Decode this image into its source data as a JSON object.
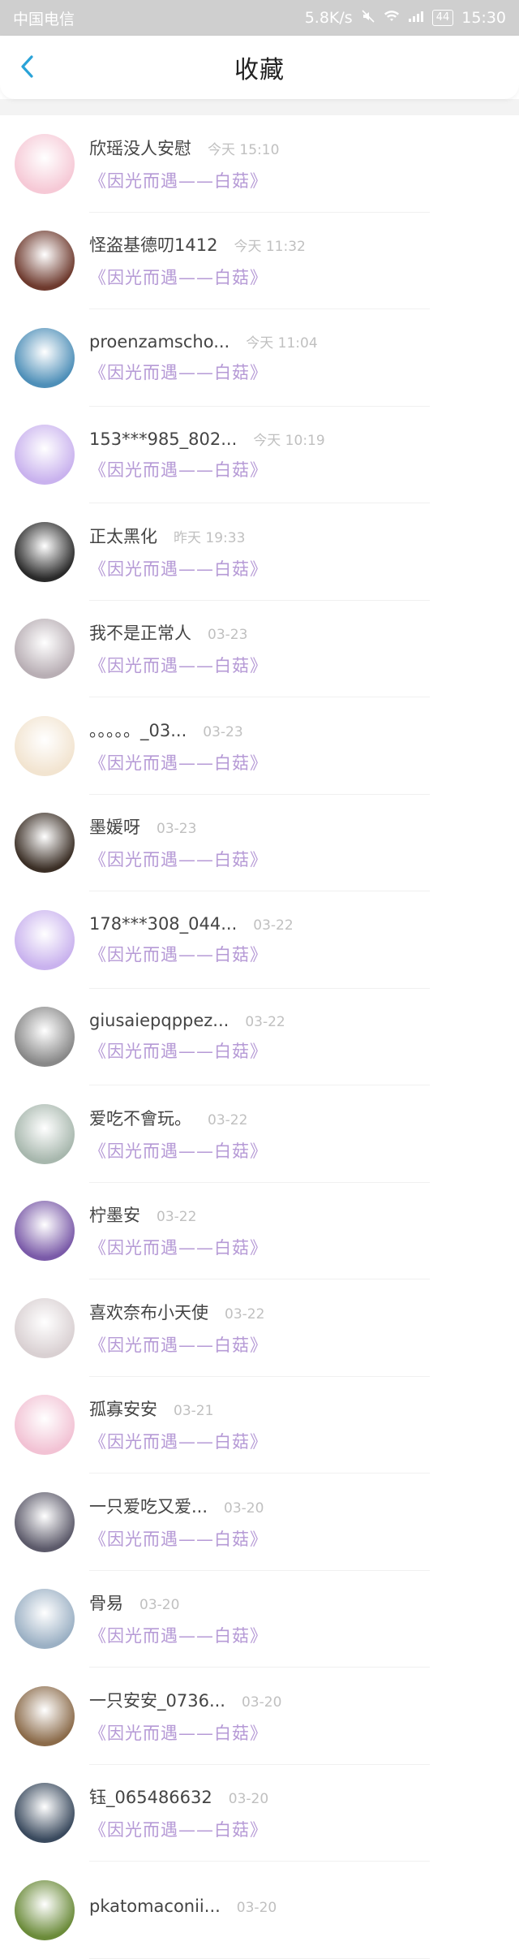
{
  "status": {
    "carrier": "中国电信",
    "speed": "5.8K/s",
    "battery": "44",
    "time": "15:30"
  },
  "header": {
    "title": "收藏"
  },
  "items": [
    {
      "name": "欣瑶没人安慰",
      "time": "今天 15:10",
      "sub": "《因光而遇——白菇》",
      "avatar": "#f6c9d6"
    },
    {
      "name": "怪盗基德叨1412",
      "time": "今天 11:32",
      "sub": "《因光而遇——白菇》",
      "avatar": "#6e3a2e"
    },
    {
      "name": "proenzamscho...",
      "time": "今天 11:04",
      "sub": "《因光而遇——白菇》",
      "avatar": "#4e8fb8"
    },
    {
      "name": "153***985_802...",
      "time": "今天 10:19",
      "sub": "《因光而遇——白菇》",
      "avatar": "#c9b2ee"
    },
    {
      "name": "正太黑化",
      "time": "昨天 19:33",
      "sub": "《因光而遇——白菇》",
      "avatar": "#2a2a2a"
    },
    {
      "name": "我不是正常人",
      "time": "03-23",
      "sub": "《因光而遇——白菇》",
      "avatar": "#b8aeb4"
    },
    {
      "name": "。。。。。_03...",
      "time": "03-23",
      "sub": "《因光而遇——白菇》",
      "avatar": "#f2e4d0"
    },
    {
      "name": "墨媛呀",
      "time": "03-23",
      "sub": "《因光而遇——白菇》",
      "avatar": "#3b2f26"
    },
    {
      "name": "178***308_044...",
      "time": "03-22",
      "sub": "《因光而遇——白菇》",
      "avatar": "#c9b2ee"
    },
    {
      "name": "giusaiepqppez...",
      "time": "03-22",
      "sub": "《因光而遇——白菇》",
      "avatar": "#888888"
    },
    {
      "name": "爱吃不會玩。",
      "time": "03-22",
      "sub": "《因光而遇——白菇》",
      "avatar": "#a7b7ad"
    },
    {
      "name": "柠墨安",
      "time": "03-22",
      "sub": "《因光而遇——白菇》",
      "avatar": "#7a5aa8"
    },
    {
      "name": "喜欢奈布小天使",
      "time": "03-22",
      "sub": "《因光而遇——白菇》",
      "avatar": "#d9d0d2"
    },
    {
      "name": "孤寡安安",
      "time": "03-21",
      "sub": "《因光而遇——白菇》",
      "avatar": "#f2c2d4"
    },
    {
      "name": "一只爱吃又爱...",
      "time": "03-20",
      "sub": "《因光而遇——白菇》",
      "avatar": "#5c5a6a"
    },
    {
      "name": "骨易",
      "time": "03-20",
      "sub": "《因光而遇——白菇》",
      "avatar": "#9bb0c4"
    },
    {
      "name": "一只安安_0736...",
      "time": "03-20",
      "sub": "《因光而遇——白菇》",
      "avatar": "#8b6b4a"
    },
    {
      "name": "钰_065486632",
      "time": "03-20",
      "sub": "《因光而遇——白菇》",
      "avatar": "#3a4a5e"
    },
    {
      "name": "pkatomaconii...",
      "time": "03-20",
      "sub": "",
      "avatar": "#6b8b3a"
    }
  ]
}
